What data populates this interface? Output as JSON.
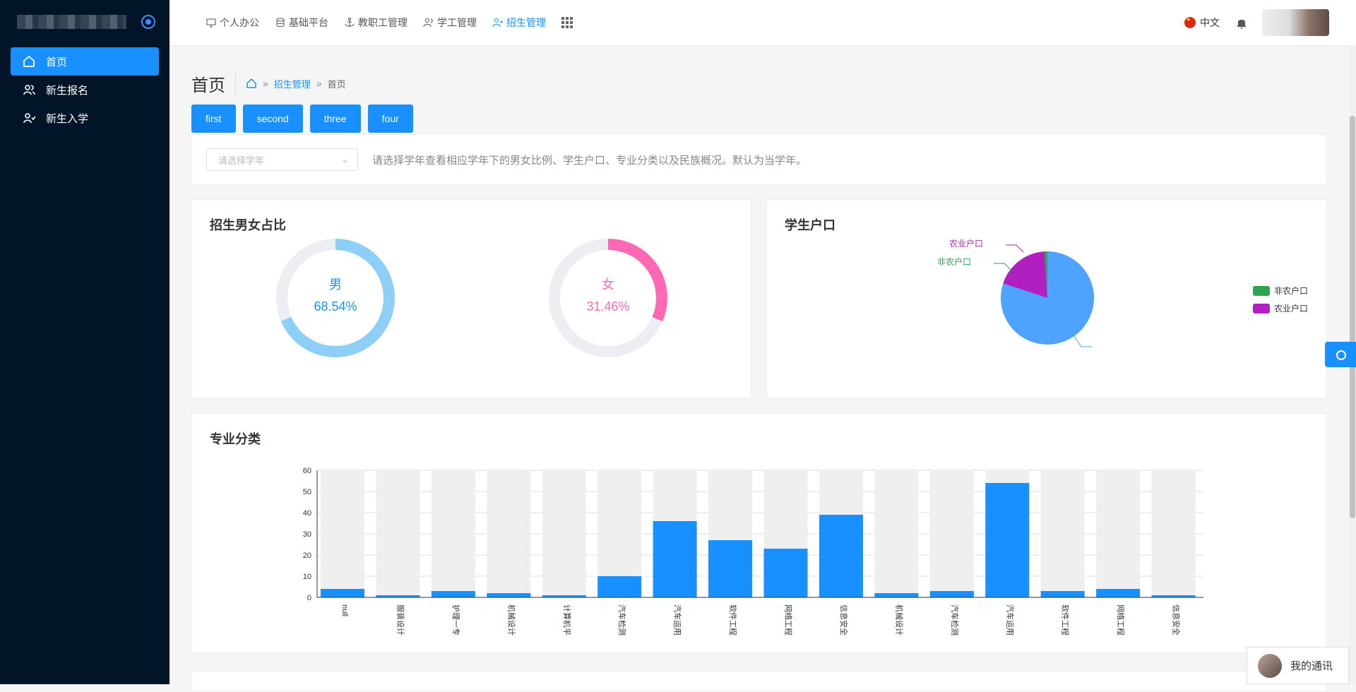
{
  "sidebar": {
    "items": [
      {
        "label": "首页",
        "icon": "home-icon",
        "active": true
      },
      {
        "label": "新生报名",
        "icon": "users-icon",
        "active": false
      },
      {
        "label": "新生入学",
        "icon": "user-check-icon",
        "active": false
      }
    ]
  },
  "topnav": {
    "items": [
      {
        "label": "个人办公",
        "icon": "monitor-icon"
      },
      {
        "label": "基础平台",
        "icon": "database-icon"
      },
      {
        "label": "教职工管理",
        "icon": "anchor-icon"
      },
      {
        "label": "学工管理",
        "icon": "users-icon"
      },
      {
        "label": "招生管理",
        "icon": "user-plus-icon",
        "active": true
      }
    ],
    "language": "中文"
  },
  "page": {
    "title": "首页",
    "breadcrumb": [
      "招生管理",
      "首页"
    ],
    "tabs": [
      "first",
      "second",
      "three",
      "four"
    ],
    "select_placeholder": "请选择学年",
    "hint": "请选择学年查看相应学年下的男女比例、学生户口、专业分类以及民族概况。默认为当学年。"
  },
  "cards": {
    "gender_title": "招生男女占比",
    "hukou_title": "学生户口",
    "major_title": "专业分类"
  },
  "chat_label": "我的通讯",
  "colors": {
    "primary": "#1890ff",
    "male": "#8ecff8",
    "female": "#ff69b4",
    "nonfarm": "#2da44e",
    "farm": "#b01fbf",
    "pie_main": "#4ea3ff"
  },
  "chart_data": [
    {
      "type": "pie",
      "title": "招生男女占比",
      "slices": [
        {
          "name": "男",
          "value": 68.54
        },
        {
          "name": "女",
          "value": 31.46
        }
      ],
      "labels": [
        "男",
        "68.54%",
        "女",
        "31.46%"
      ]
    },
    {
      "type": "pie",
      "title": "学生户口",
      "legend": [
        "非农户口",
        "农业户口"
      ],
      "slices": [
        {
          "name": "非农户口",
          "value": 1
        },
        {
          "name": "农业户口",
          "value": 19
        },
        {
          "name": "",
          "value": 80
        }
      ],
      "legend_position": "right"
    },
    {
      "type": "bar",
      "title": "专业分类",
      "categories": [
        "null",
        "服装设计",
        "护理一专",
        "机械设计",
        "计算机平",
        "汽车检测",
        "汽车运用",
        "软件工程",
        "网络工程",
        "信息安全",
        "机械设计",
        "汽车检测",
        "汽车运用",
        "软件工程",
        "网络工程",
        "信息安全"
      ],
      "values": [
        4,
        1,
        3,
        2,
        1,
        10,
        36,
        27,
        23,
        39,
        2,
        3,
        54,
        3,
        4,
        1
      ],
      "ylim": [
        0,
        60
      ],
      "yticks": [
        0,
        10,
        20,
        30,
        40,
        50,
        60
      ]
    }
  ]
}
